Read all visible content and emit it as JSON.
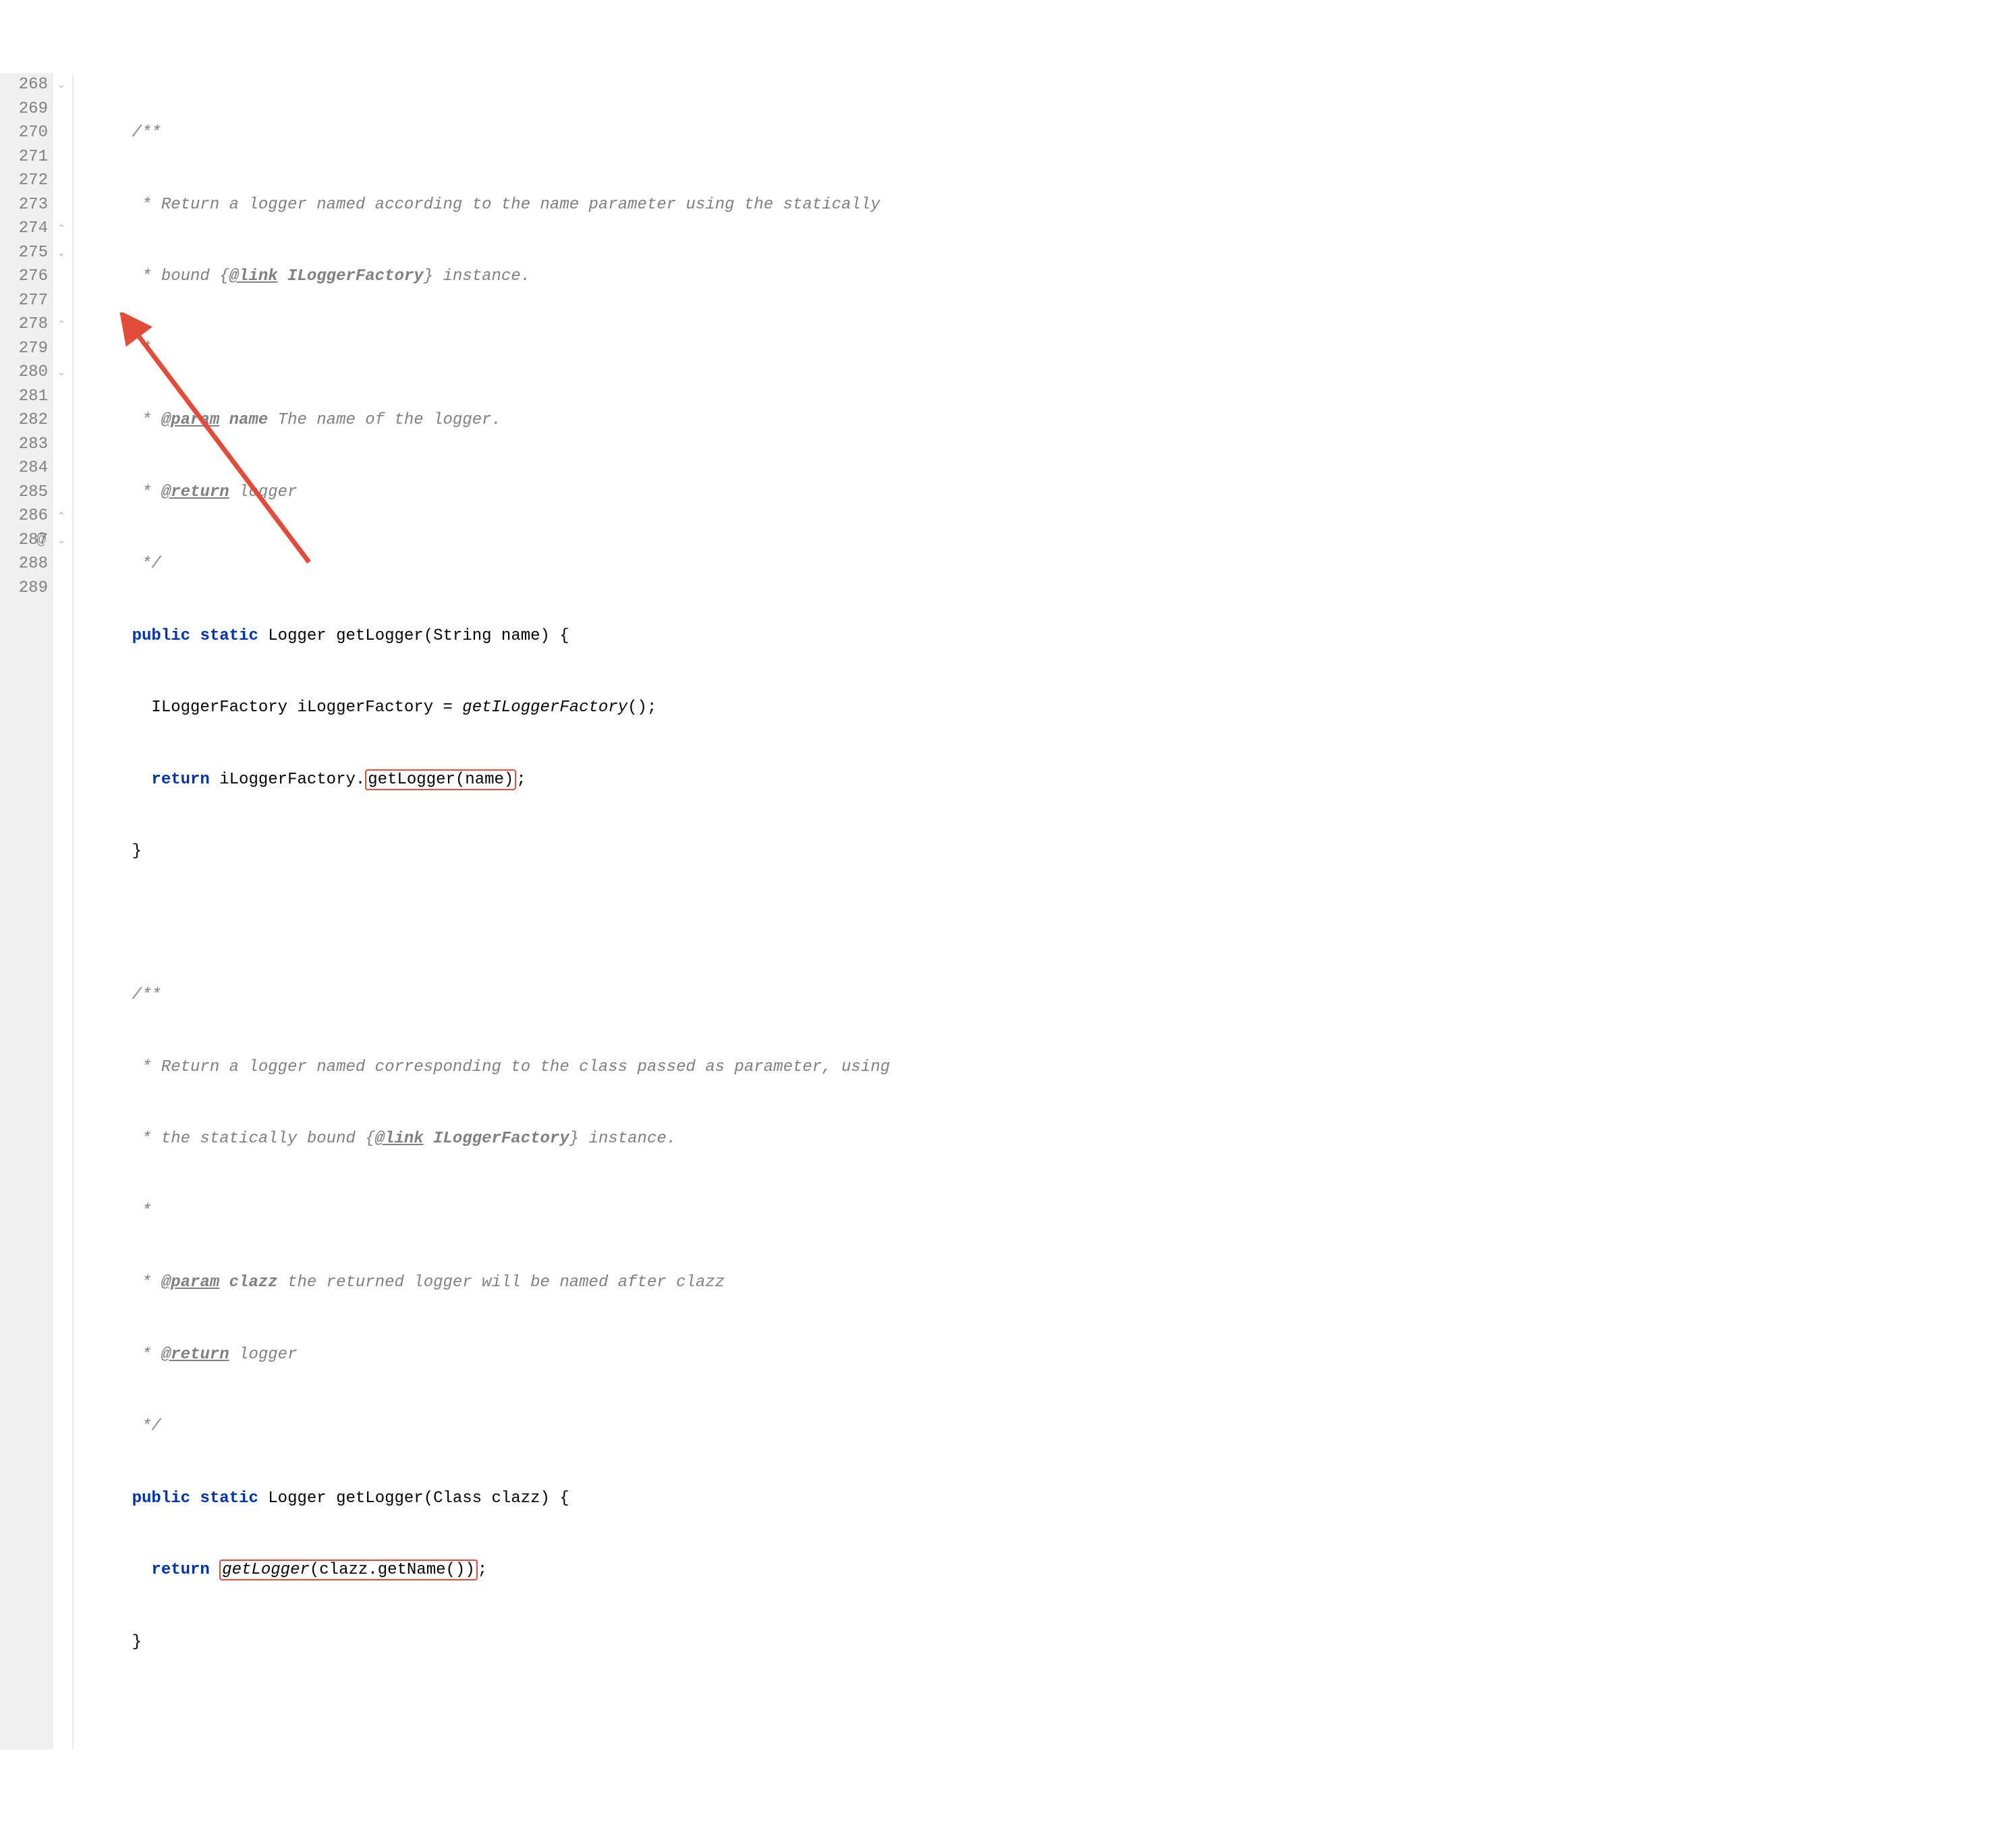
{
  "gutter": {
    "start": 268,
    "end": 289
  },
  "at_marker_line": 287,
  "code": {
    "l268": {
      "prefix": "    ",
      "t1": "/**"
    },
    "l269": {
      "prefix": "     ",
      "t1": "* Return a logger named according to the name parameter using the statically"
    },
    "l270": {
      "prefix": "     ",
      "t1": "* bound {",
      "link": "@link",
      "t2": " ILoggerFactory",
      "t3": "} instance."
    },
    "l271": {
      "prefix": "     ",
      "t1": "*"
    },
    "l272": {
      "prefix": "     ",
      "t1": "* ",
      "tag": "@param",
      "name": " name",
      "t2": " The name of the logger."
    },
    "l273": {
      "prefix": "     ",
      "t1": "* ",
      "tag": "@return",
      "t2": " logger"
    },
    "l274": {
      "prefix": "     ",
      "t1": "*/"
    },
    "l275": {
      "prefix": "    ",
      "kw1": "public",
      "sp1": " ",
      "kw2": "static",
      "t1": " Logger getLogger(String name) {"
    },
    "l276": {
      "prefix": "      ",
      "t1": "ILoggerFactory iLoggerFactory = ",
      "it": "getILoggerFactory",
      "t2": "();"
    },
    "l277": {
      "prefix": "      ",
      "kw1": "return",
      "t1": " iLoggerFactory.",
      "box": "getLogger(name)",
      "t2": ";"
    },
    "l278": {
      "prefix": "    ",
      "t1": "}"
    },
    "l279": {
      "t1": ""
    },
    "l280": {
      "prefix": "    ",
      "t1": "/**"
    },
    "l281": {
      "prefix": "     ",
      "t1": "* Return a logger named corresponding to the class passed as parameter, using"
    },
    "l282": {
      "prefix": "     ",
      "t1": "* the statically bound {",
      "link": "@link",
      "t2": " ILoggerFactory",
      "t3": "} instance."
    },
    "l283": {
      "prefix": "     ",
      "t1": "*"
    },
    "l284": {
      "prefix": "     ",
      "t1": "* ",
      "tag": "@param",
      "name": " clazz",
      "t2": " the returned logger will be named after clazz"
    },
    "l285": {
      "prefix": "     ",
      "t1": "* ",
      "tag": "@return",
      "t2": " logger"
    },
    "l286": {
      "prefix": "     ",
      "t1": "*/"
    },
    "l287": {
      "prefix": "    ",
      "kw1": "public",
      "sp1": " ",
      "kw2": "static",
      "t1": " Logger getLogger(Class clazz) {"
    },
    "l288": {
      "prefix": "      ",
      "kw1": "return",
      "t1": " ",
      "box_it": "getLogger",
      "box_rest": "(clazz.getName())",
      "t2": ";"
    },
    "l289": {
      "prefix": "    ",
      "t1": "}"
    }
  }
}
